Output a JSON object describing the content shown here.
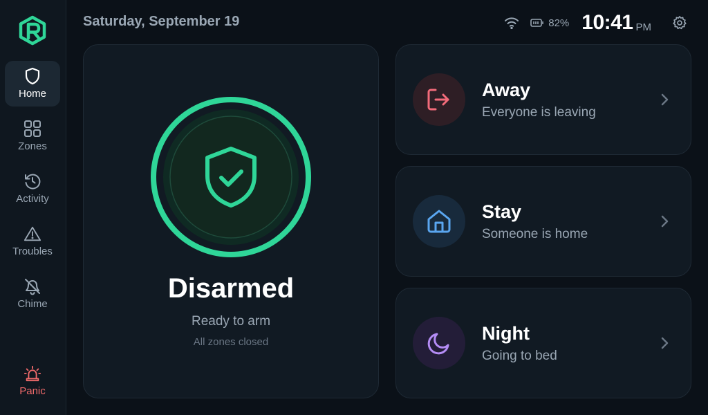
{
  "header": {
    "date": "Saturday, September 19",
    "battery_percent": "82%",
    "time": "10:41",
    "ampm": "PM"
  },
  "sidebar": {
    "items": [
      {
        "label": "Home",
        "icon": "shield-icon",
        "active": true
      },
      {
        "label": "Zones",
        "icon": "grid-icon"
      },
      {
        "label": "Activity",
        "icon": "history-icon"
      },
      {
        "label": "Troubles",
        "icon": "warning-icon"
      },
      {
        "label": "Chime",
        "icon": "bell-off-icon"
      }
    ],
    "panic": {
      "label": "Panic",
      "icon": "siren-icon"
    }
  },
  "status": {
    "title": "Disarmed",
    "subtitle": "Ready to arm",
    "detail": "All zones closed"
  },
  "modes": [
    {
      "title": "Away",
      "description": "Everyone is leaving",
      "icon": "exit-icon",
      "color": "#f26b7a"
    },
    {
      "title": "Stay",
      "description": "Someone is home",
      "icon": "home-icon",
      "color": "#5aa6f0"
    },
    {
      "title": "Night",
      "description": "Going to bed",
      "icon": "moon-icon",
      "color": "#b48cf5"
    }
  ],
  "colors": {
    "accent": "#2fd698",
    "background": "#0b1118",
    "panic": "#f26b6b"
  }
}
